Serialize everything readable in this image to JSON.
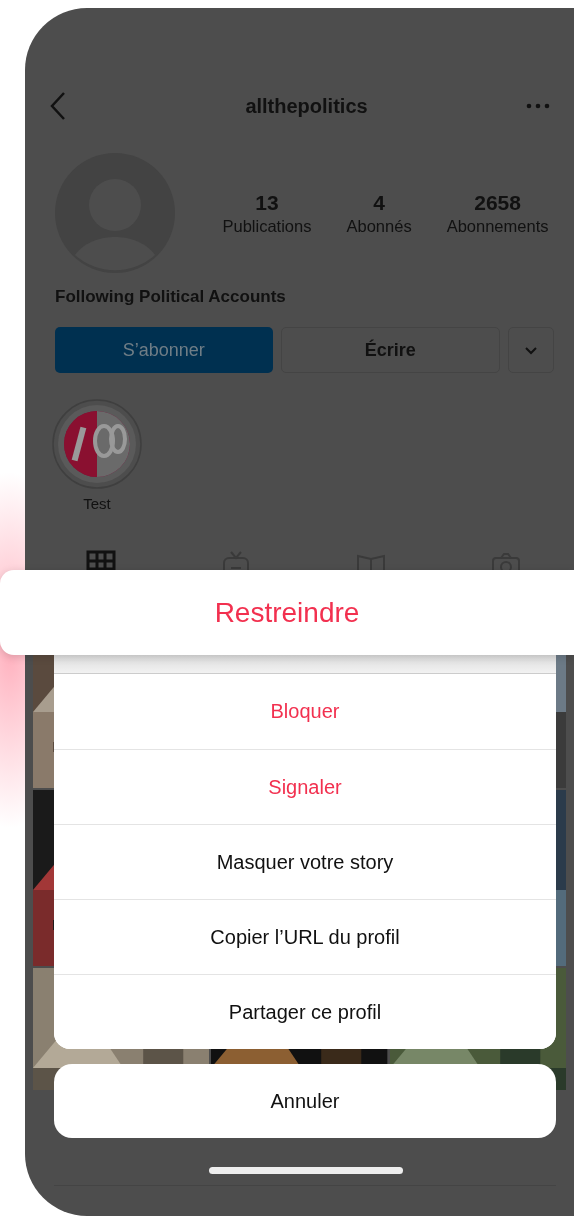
{
  "header": {
    "title": "allthepolitics"
  },
  "stats": [
    {
      "value": "13",
      "label": "Publications"
    },
    {
      "value": "4",
      "label": "Abonnés"
    },
    {
      "value": "2658",
      "label": "Abonnements"
    }
  ],
  "bio": "Following Political Accounts",
  "buttons": {
    "follow": "S’abonner",
    "message": "Écrire"
  },
  "highlights": [
    {
      "label": "Test"
    }
  ],
  "tabs": [
    {
      "kind": "grid",
      "selected": true
    },
    {
      "kind": "tv",
      "selected": false
    },
    {
      "kind": "guide",
      "selected": false
    },
    {
      "kind": "tagged",
      "selected": false
    }
  ],
  "focused_action": {
    "label": "Restreindre",
    "destructive": true
  },
  "actions": [
    {
      "label": "Bloquer",
      "destructive": true
    },
    {
      "label": "Signaler",
      "destructive": true
    },
    {
      "label": "Masquer votre story",
      "destructive": false
    },
    {
      "label": "Copier l’URL du profil",
      "destructive": false
    },
    {
      "label": "Partager ce profil",
      "destructive": false
    }
  ],
  "cancel": "Annuler"
}
